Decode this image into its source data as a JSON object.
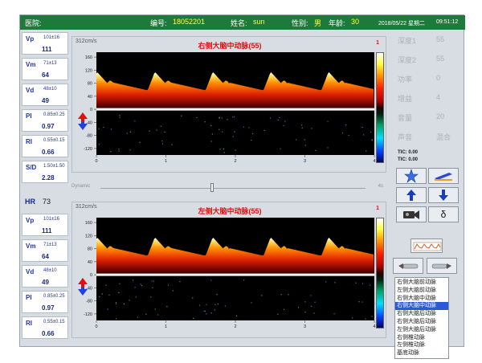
{
  "header": {
    "hospital_label": "医院:",
    "id_label": "编号:",
    "id_value": "18052201",
    "name_label": "姓名:",
    "name_value": "sun",
    "sex_label": "性别:",
    "sex_value": "男",
    "age_label": "年龄:",
    "age_value": "30",
    "date": "2018/05/22 星期二",
    "time": "09:51:12"
  },
  "measurements_top": [
    {
      "key": "Vp",
      "range": "101±16",
      "value": "111"
    },
    {
      "key": "Vm",
      "range": "71±13",
      "value": "64"
    },
    {
      "key": "Vd",
      "range": "48±10",
      "value": "49"
    },
    {
      "key": "PI",
      "range": "0.85±0.25",
      "value": "0.97"
    },
    {
      "key": "RI",
      "range": "0.55±0.15",
      "value": "0.66"
    },
    {
      "key": "S/D",
      "range": "1.50±1.50",
      "value": "2.28"
    }
  ],
  "hr": {
    "key": "HR",
    "value": "73"
  },
  "measurements_bottom": [
    {
      "key": "Vp",
      "range": "101±16",
      "value": "111"
    },
    {
      "key": "Vm",
      "range": "71±13",
      "value": "64"
    },
    {
      "key": "Vd",
      "range": "48±10",
      "value": "49"
    },
    {
      "key": "PI",
      "range": "0.85±0.25",
      "value": "0.97"
    },
    {
      "key": "RI",
      "range": "0.55±0.15",
      "value": "0.66"
    },
    {
      "key": "S/D",
      "range": "1.50±1.50",
      "value": "2.28"
    }
  ],
  "panel_top": {
    "scale": "312cm/s",
    "title": "右侧大脑中动脉(55)",
    "number": "1"
  },
  "panel_bottom": {
    "scale": "312cm/s",
    "title": "左侧大脑中动脉(55)",
    "number": "1"
  },
  "dynamic": {
    "label": "Dynamic",
    "end": "4s",
    "level": 0.42
  },
  "spectrum": {
    "y_ticks": [
      "160",
      "120",
      "80",
      "40",
      "0",
      "-40",
      "-80",
      "-120"
    ],
    "y_values": [
      160,
      120,
      80,
      40,
      0,
      -40,
      -80,
      -120
    ],
    "x_ticks": [
      "0",
      "1",
      "2",
      "3",
      "4"
    ],
    "x_values": [
      0,
      1,
      2,
      3,
      4
    ]
  },
  "params": [
    {
      "key": "深度1",
      "value": "55"
    },
    {
      "key": "深度2",
      "value": "55"
    },
    {
      "key": "功率",
      "value": "0"
    },
    {
      "key": "增益",
      "value": "4"
    },
    {
      "key": "音量",
      "value": "20"
    },
    {
      "key": "声音",
      "value": "混合"
    }
  ],
  "tic": [
    "TIC: 0.00",
    "TIC: 0.00"
  ],
  "icons": [
    "freeze-star-icon",
    "probe-icon",
    "depth-up-icon",
    "depth-down-icon",
    "video-camera-icon",
    "delta-icon",
    "waveform-icon",
    "probe-left-icon",
    "probe-right-icon"
  ],
  "delta_glyph": "δ",
  "arteries": [
    {
      "label": "右侧大脑前动脉",
      "selected": false
    },
    {
      "label": "左侧大脑前动脉",
      "selected": false
    },
    {
      "label": "右侧大脑中动脉",
      "selected": false
    },
    {
      "label": "右侧大脑中动脉",
      "selected": true
    },
    {
      "label": "右侧大脑后动脉",
      "selected": false
    },
    {
      "label": "右侧大脑后动脉",
      "selected": false
    },
    {
      "label": "左侧大脑后动脉",
      "selected": false
    },
    {
      "label": "右侧椎动脉",
      "selected": false
    },
    {
      "label": "左侧椎动脉",
      "selected": false
    },
    {
      "label": "基底动脉",
      "selected": false
    }
  ],
  "colors": {
    "header_bg": "#1e7a3a",
    "header_value": "#ffff33",
    "title_red": "#e01010",
    "measure_blue": "#2233aa",
    "selection_blue": "#2a5ad8"
  }
}
